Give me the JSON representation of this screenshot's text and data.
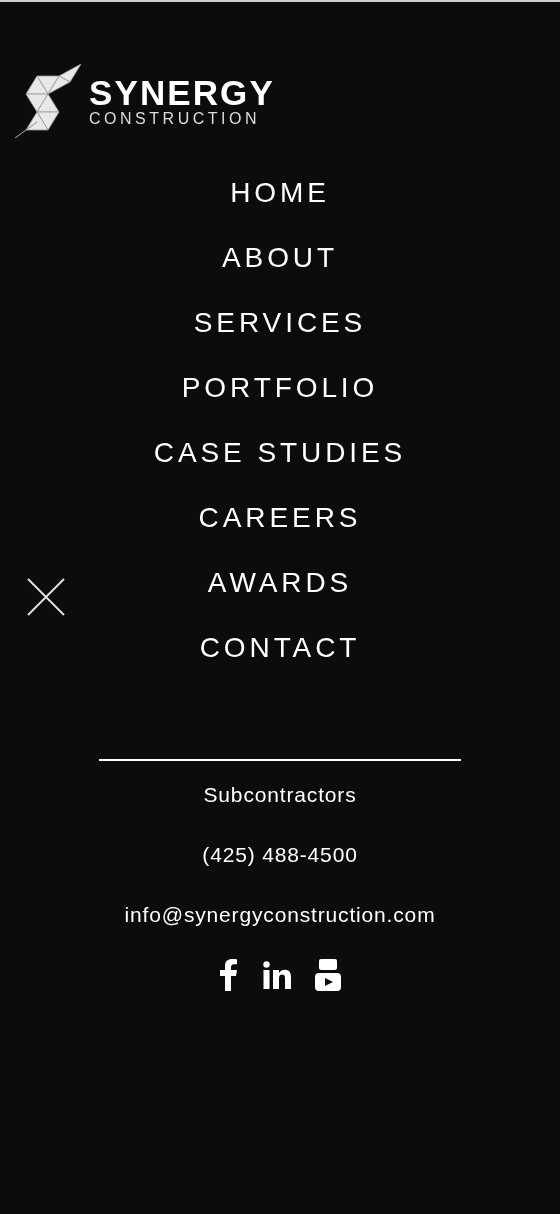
{
  "logo": {
    "name": "SYNERGY",
    "tagline": "CONSTRUCTION"
  },
  "nav": [
    {
      "label": "HOME"
    },
    {
      "label": "ABOUT"
    },
    {
      "label": "SERVICES"
    },
    {
      "label": "PORTFOLIO"
    },
    {
      "label": "CASE STUDIES"
    },
    {
      "label": "CAREERS"
    },
    {
      "label": "AWARDS"
    },
    {
      "label": "CONTACT"
    }
  ],
  "footer_links": [
    "Subcontractors",
    "(425) 488-4500",
    "info@synergyconstruction.com"
  ]
}
